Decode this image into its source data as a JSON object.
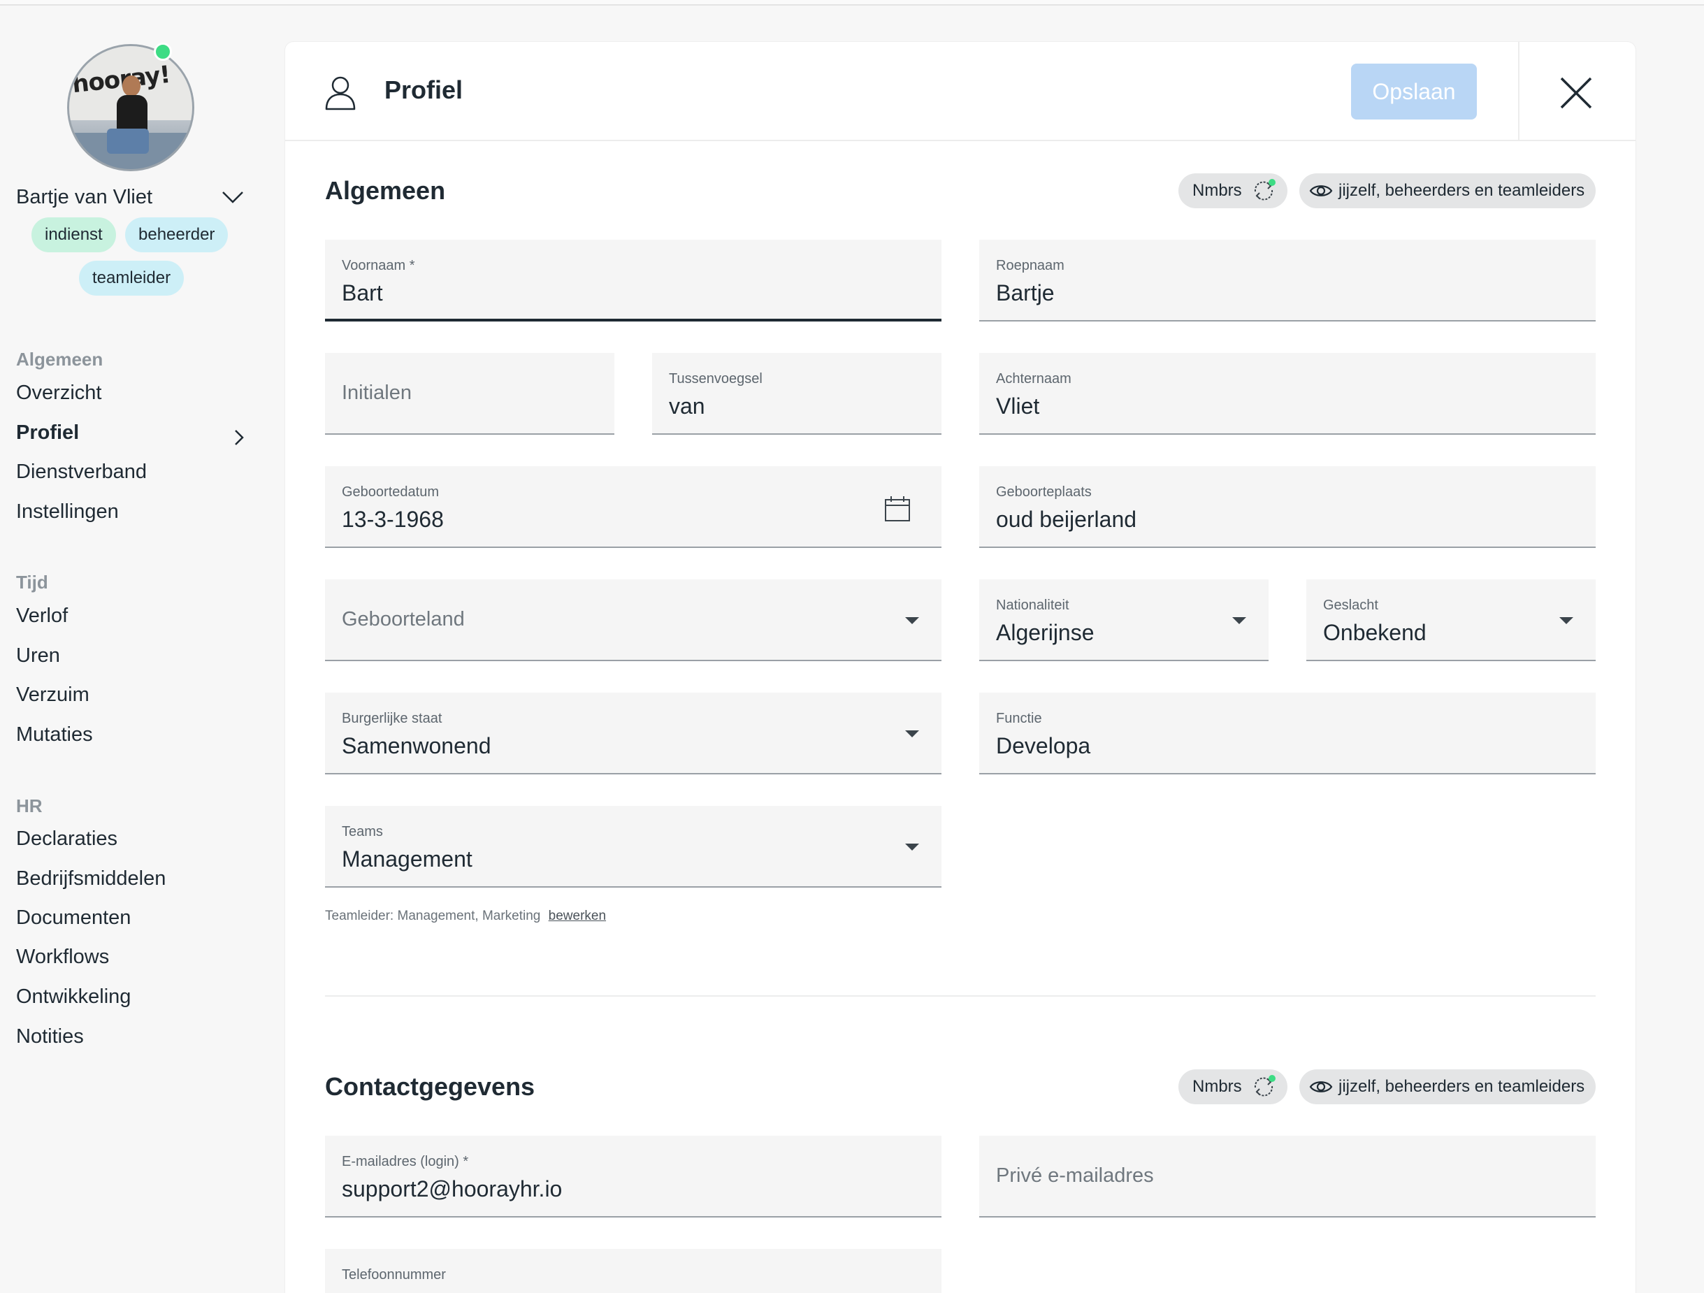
{
  "user": {
    "name": "Bartje van Vliet",
    "badges": [
      "indienst",
      "beheerder",
      "teamleider"
    ]
  },
  "nav": {
    "sections": [
      {
        "title": "Algemeen",
        "items": [
          "Overzicht",
          "Profiel",
          "Dienstverband",
          "Instellingen"
        ]
      },
      {
        "title": "Tijd",
        "items": [
          "Verlof",
          "Uren",
          "Verzuim",
          "Mutaties"
        ]
      },
      {
        "title": "HR",
        "items": [
          "Declaraties",
          "Bedrijfsmiddelen",
          "Documenten",
          "Workflows",
          "Ontwikkeling",
          "Notities"
        ]
      }
    ],
    "active": "Profiel"
  },
  "header": {
    "title": "Profiel",
    "save_label": "Opslaan"
  },
  "algemeen": {
    "title": "Algemeen",
    "source_label": "Nmbrs",
    "visibility_label": "jijzelf, beheerders en teamleiders",
    "fields": {
      "voornaam": {
        "label": "Voornaam *",
        "value": "Bart"
      },
      "roepnaam": {
        "label": "Roepnaam",
        "value": "Bartje"
      },
      "initialen": {
        "placeholder": "Initialen"
      },
      "tussenvoegsel": {
        "label": "Tussenvoegsel",
        "value": "van"
      },
      "achternaam": {
        "label": "Achternaam",
        "value": "Vliet"
      },
      "geboortedatum": {
        "label": "Geboortedatum",
        "value": "13-3-1968"
      },
      "geboorteplaats": {
        "label": "Geboorteplaats",
        "value": "oud beijerland"
      },
      "geboorteland": {
        "placeholder": "Geboorteland"
      },
      "nationaliteit": {
        "label": "Nationaliteit",
        "value": "Algerijnse"
      },
      "geslacht": {
        "label": "Geslacht",
        "value": "Onbekend"
      },
      "burgerlijke_staat": {
        "label": "Burgerlijke staat",
        "value": "Samenwonend"
      },
      "functie": {
        "label": "Functie",
        "value": "Developa"
      },
      "teams": {
        "label": "Teams",
        "value": "Management"
      }
    },
    "helper_text": "Teamleider: Management, Marketing",
    "helper_link": "bewerken"
  },
  "contact": {
    "title": "Contactgegevens",
    "source_label": "Nmbrs",
    "visibility_label": "jijzelf, beheerders en teamleiders",
    "fields": {
      "email": {
        "label": "E-mailadres (login) *",
        "value": "support2@hoorayhr.io"
      },
      "prive_email": {
        "placeholder": "Privé e-mailadres"
      },
      "telefoon": {
        "label": "Telefoonnummer"
      }
    }
  },
  "colors": {
    "accent": "#b9d6f5",
    "badge_green": "#c8f2df",
    "badge_blue": "#cdeff7",
    "status_online": "#3ddc84"
  }
}
